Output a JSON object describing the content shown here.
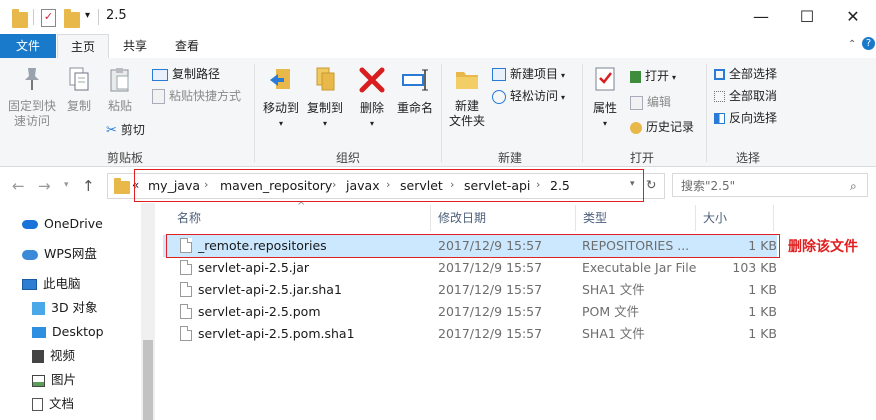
{
  "window": {
    "title": "2.5",
    "controls": {
      "minimize": "—",
      "maximize": "☐",
      "close": "✕"
    }
  },
  "ribbon_tabs": {
    "file": "文件",
    "home": "主页",
    "share": "共享",
    "view": "查看"
  },
  "ribbon": {
    "clipboard": {
      "label": "剪贴板",
      "pin": "固定到快\n速访问",
      "copy": "复制",
      "paste": "粘贴",
      "copy_path": "复制路径",
      "paste_shortcut": "粘贴快捷方式",
      "cut": "剪切"
    },
    "organize": {
      "label": "组织",
      "move_to": "移动到",
      "copy_to": "复制到",
      "delete": "删除",
      "rename": "重命名"
    },
    "new": {
      "label": "新建",
      "new_folder": "新建\n文件夹",
      "new_item": "新建项目",
      "easy_access": "轻松访问"
    },
    "open": {
      "label": "打开",
      "properties": "属性",
      "open": "打开",
      "edit": "编辑",
      "history": "历史记录"
    },
    "select": {
      "label": "选择",
      "select_all": "全部选择",
      "select_none": "全部取消",
      "invert": "反向选择"
    }
  },
  "address": {
    "breadcrumbs": [
      "my_java",
      "maven_repository",
      "javax",
      "servlet",
      "servlet-api",
      "2.5"
    ],
    "overflow": "«",
    "search_placeholder": "搜索\"2.5\""
  },
  "nav_pane": {
    "items": [
      {
        "label": "OneDrive",
        "icon": "cloud-icon",
        "color": "#1a73d9"
      },
      {
        "label": "WPS网盘",
        "icon": "cloud-icon",
        "color": "#3a8ad8"
      },
      {
        "label": "此电脑",
        "icon": "computer-icon",
        "color": "#2d7dd2"
      },
      {
        "label": "3D 对象",
        "icon": "cube-icon",
        "color": "#4aa8e8"
      },
      {
        "label": "Desktop",
        "icon": "desktop-icon",
        "color": "#2d8fe0"
      },
      {
        "label": "视频",
        "icon": "video-icon",
        "color": "#444444"
      },
      {
        "label": "图片",
        "icon": "picture-icon",
        "color": "#444444"
      },
      {
        "label": "文档",
        "icon": "document-icon",
        "color": "#555555"
      }
    ]
  },
  "file_list": {
    "columns": {
      "name": "名称",
      "date": "修改日期",
      "type": "类型",
      "size": "大小"
    },
    "rows": [
      {
        "name": "_remote.repositories",
        "date": "2017/12/9 15:57",
        "type": "REPOSITORIES ...",
        "size": "1 KB"
      },
      {
        "name": "servlet-api-2.5.jar",
        "date": "2017/12/9 15:57",
        "type": "Executable Jar File",
        "size": "103 KB"
      },
      {
        "name": "servlet-api-2.5.jar.sha1",
        "date": "2017/12/9 15:57",
        "type": "SHA1 文件",
        "size": "1 KB"
      },
      {
        "name": "servlet-api-2.5.pom",
        "date": "2017/12/9 15:57",
        "type": "POM 文件",
        "size": "1 KB"
      },
      {
        "name": "servlet-api-2.5.pom.sha1",
        "date": "2017/12/9 15:57",
        "type": "SHA1 文件",
        "size": "1 KB"
      }
    ]
  },
  "annotation": {
    "text": "删除该文件",
    "color": "#e02020"
  }
}
